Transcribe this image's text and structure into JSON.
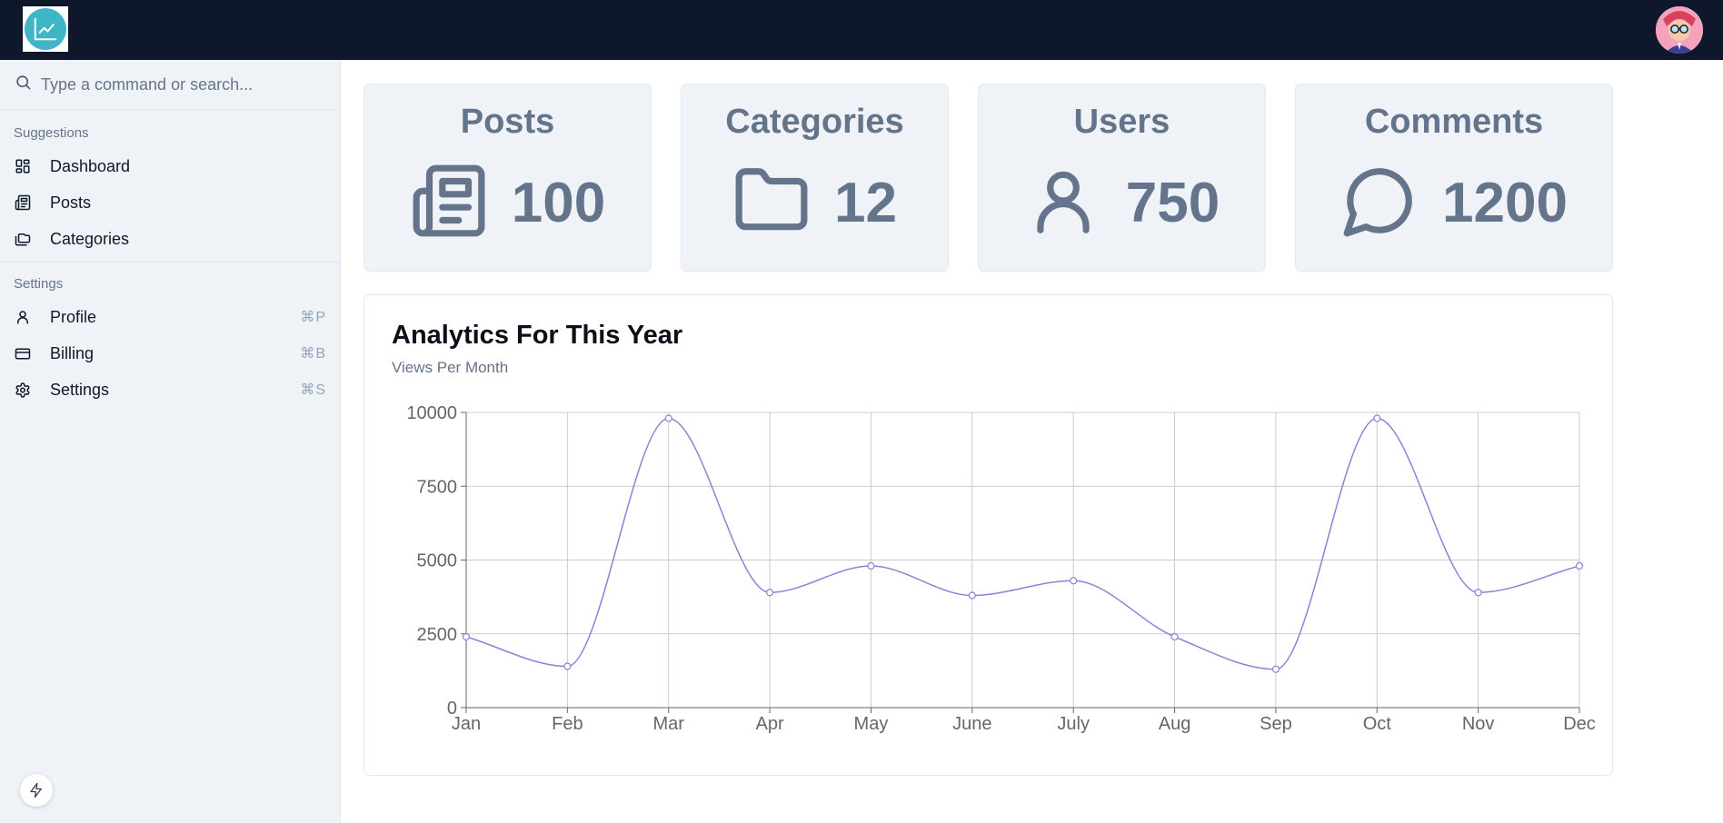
{
  "header": {
    "logo_icon": "chart-line-icon",
    "avatar_icon": "user-avatar-icon"
  },
  "sidebar": {
    "search": {
      "placeholder": "Type a command or search...",
      "icon": "search-icon"
    },
    "groups": [
      {
        "label": "Suggestions",
        "items": [
          {
            "label": "Dashboard",
            "icon": "dashboard-icon"
          },
          {
            "label": "Posts",
            "icon": "newspaper-icon"
          },
          {
            "label": "Categories",
            "icon": "folders-icon"
          }
        ]
      },
      {
        "label": "Settings",
        "items": [
          {
            "label": "Profile",
            "icon": "user-icon",
            "shortcut": "⌘P"
          },
          {
            "label": "Billing",
            "icon": "credit-card-icon",
            "shortcut": "⌘B"
          },
          {
            "label": "Settings",
            "icon": "gear-icon",
            "shortcut": "⌘S"
          }
        ]
      }
    ],
    "footer_icon": "bolt-icon"
  },
  "stats": [
    {
      "title": "Posts",
      "value": "100",
      "icon": "newspaper-icon"
    },
    {
      "title": "Categories",
      "value": "12",
      "icon": "folder-icon"
    },
    {
      "title": "Users",
      "value": "750",
      "icon": "user-icon"
    },
    {
      "title": "Comments",
      "value": "1200",
      "icon": "message-circle-icon"
    }
  ],
  "analytics": {
    "title": "Analytics For This Year",
    "subtitle": "Views Per Month"
  },
  "colors": {
    "topbar": "#0f172a",
    "sidebar": "#eff3f8",
    "card": "#eff3f8",
    "stat_text": "#64748b",
    "line": "#8884d8",
    "logo": "#3fb6c8"
  },
  "chart_data": {
    "type": "line",
    "categories": [
      "Jan",
      "Feb",
      "Mar",
      "Apr",
      "May",
      "June",
      "July",
      "Aug",
      "Sep",
      "Oct",
      "Nov",
      "Dec"
    ],
    "series": [
      {
        "values": [
          2400,
          1400,
          9800,
          3900,
          4800,
          3800,
          4300,
          2400,
          1300,
          9800,
          3900,
          4800
        ]
      }
    ],
    "yticks": [
      0,
      2500,
      5000,
      7500,
      10000
    ],
    "ylim": [
      0,
      10000
    ],
    "grid": true,
    "curve": "smooth",
    "xlabel": "",
    "ylabel": ""
  }
}
